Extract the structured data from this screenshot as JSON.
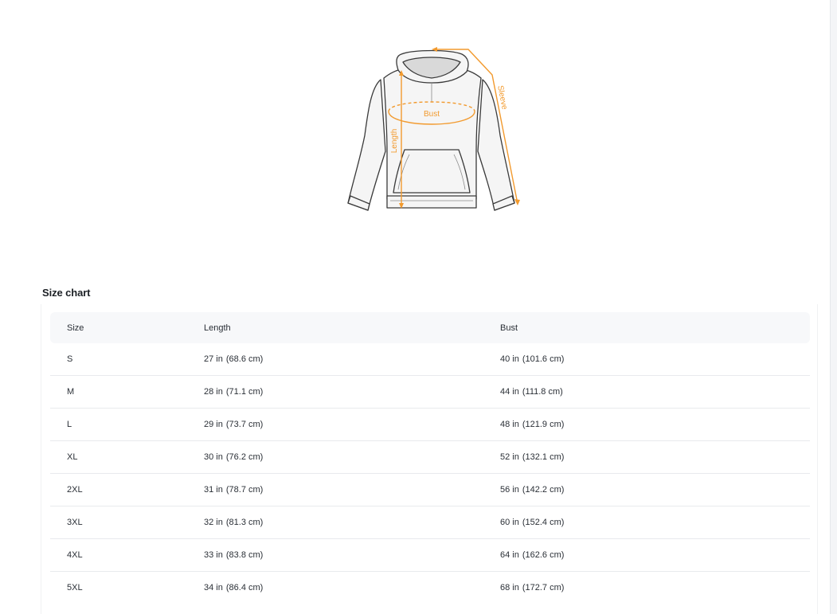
{
  "illustration": {
    "labels": {
      "bust": "Bust",
      "length": "Length",
      "sleeve": "Sleeve"
    },
    "accent_color": "#f29a2e",
    "outline_color": "#3a3a3a",
    "fill_color": "#f5f5f5"
  },
  "size_chart": {
    "title": "Size chart",
    "headers": [
      "Size",
      "Length",
      "Bust"
    ],
    "rows": [
      {
        "size": "S",
        "length_in": "27 in",
        "length_cm": "(68.6 cm)",
        "bust_in": "40 in",
        "bust_cm": "(101.6 cm)"
      },
      {
        "size": "M",
        "length_in": "28 in",
        "length_cm": "(71.1 cm)",
        "bust_in": "44 in",
        "bust_cm": "(111.8 cm)"
      },
      {
        "size": "L",
        "length_in": "29 in",
        "length_cm": "(73.7 cm)",
        "bust_in": "48 in",
        "bust_cm": "(121.9 cm)"
      },
      {
        "size": "XL",
        "length_in": "30 in",
        "length_cm": "(76.2 cm)",
        "bust_in": "52 in",
        "bust_cm": "(132.1 cm)"
      },
      {
        "size": "2XL",
        "length_in": "31 in",
        "length_cm": "(78.7 cm)",
        "bust_in": "56 in",
        "bust_cm": "(142.2 cm)"
      },
      {
        "size": "3XL",
        "length_in": "32 in",
        "length_cm": "(81.3 cm)",
        "bust_in": "60 in",
        "bust_cm": "(152.4 cm)"
      },
      {
        "size": "4XL",
        "length_in": "33 in",
        "length_cm": "(83.8 cm)",
        "bust_in": "64 in",
        "bust_cm": "(162.6 cm)"
      },
      {
        "size": "5XL",
        "length_in": "34 in",
        "length_cm": "(86.4 cm)",
        "bust_in": "68 in",
        "bust_cm": "(172.7 cm)"
      }
    ]
  }
}
